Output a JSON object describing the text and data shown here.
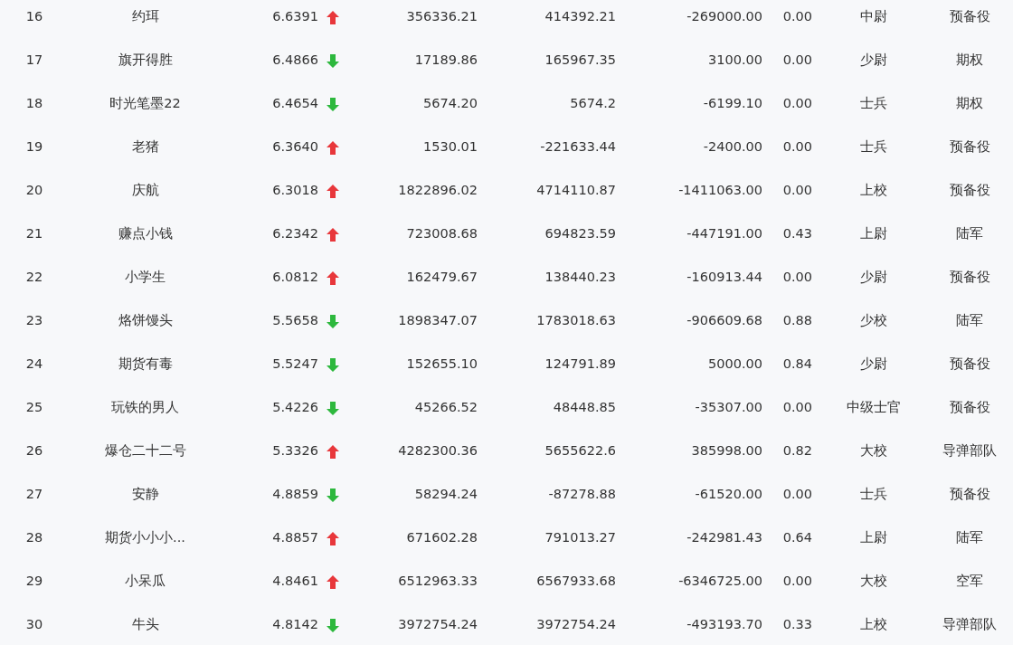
{
  "table": {
    "rows": [
      {
        "cells": [
          "16",
          "约珥",
          "6.6391",
          "356336.21",
          "414392.21",
          "-269000.00",
          "0.00",
          "中尉",
          "预备役"
        ],
        "rising": true
      },
      {
        "cells": [
          "17",
          "旗开得胜",
          "6.4866",
          "17189.86",
          "165967.35",
          "3100.00",
          "0.00",
          "少尉",
          "期权"
        ],
        "rising": false
      },
      {
        "cells": [
          "18",
          "时光笔墨22",
          "6.4654",
          "5674.20",
          "5674.2",
          "-6199.10",
          "0.00",
          "士兵",
          "期权"
        ],
        "rising": false
      },
      {
        "cells": [
          "19",
          "老猪",
          "6.3640",
          "1530.01",
          "-221633.44",
          "-2400.00",
          "0.00",
          "士兵",
          "预备役"
        ],
        "rising": true
      },
      {
        "cells": [
          "20",
          "庆航",
          "6.3018",
          "1822896.02",
          "4714110.87",
          "-1411063.00",
          "0.00",
          "上校",
          "预备役"
        ],
        "rising": true
      },
      {
        "cells": [
          "21",
          "赚点小钱",
          "6.2342",
          "723008.68",
          "694823.59",
          "-447191.00",
          "0.43",
          "上尉",
          "陆军"
        ],
        "rising": true
      },
      {
        "cells": [
          "22",
          "小学生",
          "6.0812",
          "162479.67",
          "138440.23",
          "-160913.44",
          "0.00",
          "少尉",
          "预备役"
        ],
        "rising": true
      },
      {
        "cells": [
          "23",
          "烙饼馒头",
          "5.5658",
          "1898347.07",
          "1783018.63",
          "-906609.68",
          "0.88",
          "少校",
          "陆军"
        ],
        "rising": false
      },
      {
        "cells": [
          "24",
          "期货有毒",
          "5.5247",
          "152655.10",
          "124791.89",
          "5000.00",
          "0.84",
          "少尉",
          "预备役"
        ],
        "rising": false
      },
      {
        "cells": [
          "25",
          "玩铁的男人",
          "5.4226",
          "45266.52",
          "48448.85",
          "-35307.00",
          "0.00",
          "中级士官",
          "预备役"
        ],
        "rising": false
      },
      {
        "cells": [
          "26",
          "爆仓二十二号",
          "5.3326",
          "4282300.36",
          "5655622.6",
          "385998.00",
          "0.82",
          "大校",
          "导弹部队"
        ],
        "rising": true
      },
      {
        "cells": [
          "27",
          "安静",
          "4.8859",
          "58294.24",
          "-87278.88",
          "-61520.00",
          "0.00",
          "士兵",
          "预备役"
        ],
        "rising": false
      },
      {
        "cells": [
          "28",
          "期货小小小...",
          "4.8857",
          "671602.28",
          "791013.27",
          "-242981.43",
          "0.64",
          "上尉",
          "陆军"
        ],
        "rising": true
      },
      {
        "cells": [
          "29",
          "小呆瓜",
          "4.8461",
          "6512963.33",
          "6567933.68",
          "-6346725.00",
          "0.00",
          "大校",
          "空军"
        ],
        "rising": true
      },
      {
        "cells": [
          "30",
          "牛头",
          "4.8142",
          "3972754.24",
          "3972754.24",
          "-493193.70",
          "0.33",
          "上校",
          "导弹部队"
        ],
        "rising": false
      }
    ]
  }
}
